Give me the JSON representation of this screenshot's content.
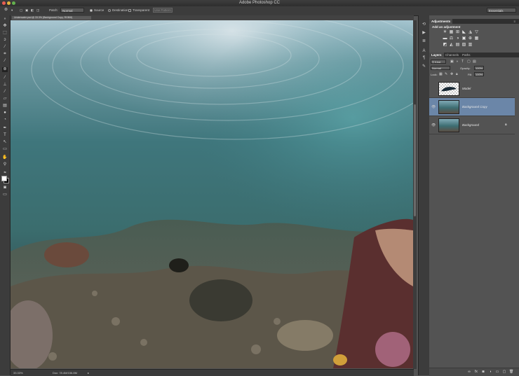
{
  "window": {
    "title": "Adobe Photoshop CC",
    "workspace": "Essentials"
  },
  "options_bar": {
    "patch_label": "Patch:",
    "patch_mode": "Normal",
    "source_label": "Source",
    "destination_label": "Destination",
    "transparent_label": "Transparent",
    "use_pattern_label": "Use Pattern"
  },
  "document": {
    "tab_title": "Underwater.psd @ 33.3% (Background Copy, RGB/8)",
    "zoom": "33.33%",
    "doc_info": "Doc: 78.4M/156.8M"
  },
  "adjustments_panel": {
    "tab_label": "Adjustments",
    "heading": "Add an adjustment",
    "row1": [
      "☀",
      "▦",
      "⊞",
      "◣",
      "◮",
      "▽"
    ],
    "row2": [
      "▬",
      "⚖",
      "◑",
      "▣",
      "⊕",
      "▦"
    ],
    "row3": [
      "◩",
      "◭",
      "▤",
      "▧",
      "▥"
    ]
  },
  "layers_panel": {
    "tabs": [
      "Layers",
      "Channels",
      "Paths"
    ],
    "kind_label": "Kind",
    "blend_mode": "Normal",
    "opacity_label": "Opacity:",
    "opacity_value": "100%",
    "lock_label": "Lock:",
    "fill_label": "Fill:",
    "fill_value": "100%",
    "layers": [
      {
        "name": "Model",
        "visible": false,
        "selected": false
      },
      {
        "name": "Background Copy",
        "visible": true,
        "selected": true
      },
      {
        "name": "Background",
        "visible": true,
        "selected": false,
        "locked": true
      }
    ]
  },
  "colors": {
    "panel_bg": "#535353",
    "selected_layer": "#6b86a8",
    "water_top": "#8fb8c9",
    "water_mid": "#3f7f86"
  }
}
